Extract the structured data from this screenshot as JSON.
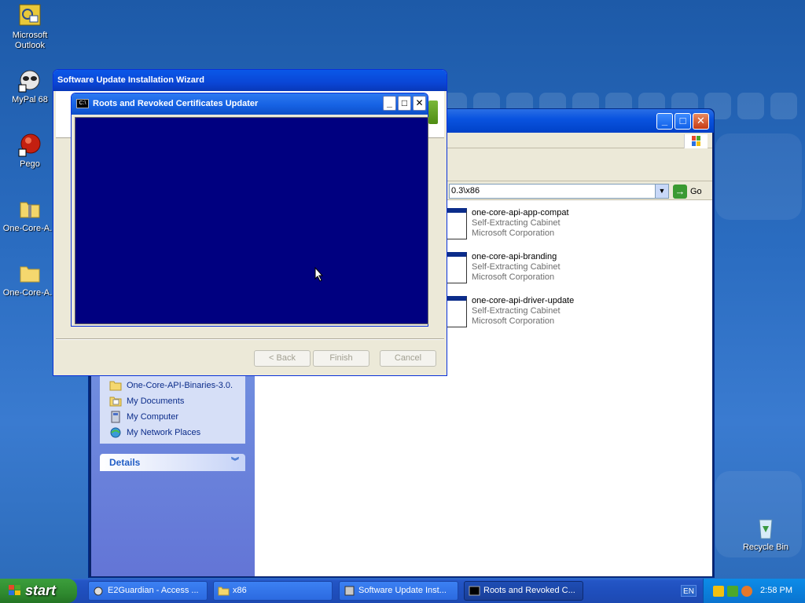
{
  "desktop": {
    "icons": [
      {
        "label": "Microsoft Outlook"
      },
      {
        "label": "MyPal 68"
      },
      {
        "label": "Pego"
      },
      {
        "label": "One-Core-A..."
      },
      {
        "label": "One-Core-A..."
      },
      {
        "label": "Recycle Bin"
      }
    ]
  },
  "explorer": {
    "address_value": "0.3\\x86",
    "go_label": "Go",
    "files": [
      {
        "name": "one-core-api-app-compat",
        "type": "Self-Extracting Cabinet",
        "company": "Microsoft Corporation"
      },
      {
        "name": "one-core-api-branding",
        "type": "Self-Extracting Cabinet",
        "company": "Microsoft Corporation"
      },
      {
        "name": "one-core-api-driver-update",
        "type": "Self-Extracting Cabinet",
        "company": "Microsoft Corporation"
      }
    ],
    "other_places": [
      {
        "label": "One-Core-API-Binaries-3.0."
      },
      {
        "label": "My Documents"
      },
      {
        "label": "My Computer"
      },
      {
        "label": "My Network Places"
      }
    ],
    "details_label": "Details"
  },
  "wizard": {
    "title": "Software Update Installation Wizard",
    "back_label": "< Back",
    "finish_label": "Finish",
    "cancel_label": "Cancel"
  },
  "console": {
    "title": "Roots and Revoked Certificates Updater",
    "icon_text": "C:\\"
  },
  "taskbar": {
    "start_label": "start",
    "tasks": [
      {
        "label": "E2Guardian - Access ..."
      },
      {
        "label": "x86"
      },
      {
        "label": "Software Update Inst..."
      },
      {
        "label": "Roots and Revoked C..."
      }
    ],
    "lang": "EN",
    "clock": "2:58 PM"
  },
  "colors": {
    "console_bg": "#000080",
    "title_blue": "#0a58e8",
    "taskbar_blue": "#2456c6",
    "start_green": "#2f8a2f"
  }
}
